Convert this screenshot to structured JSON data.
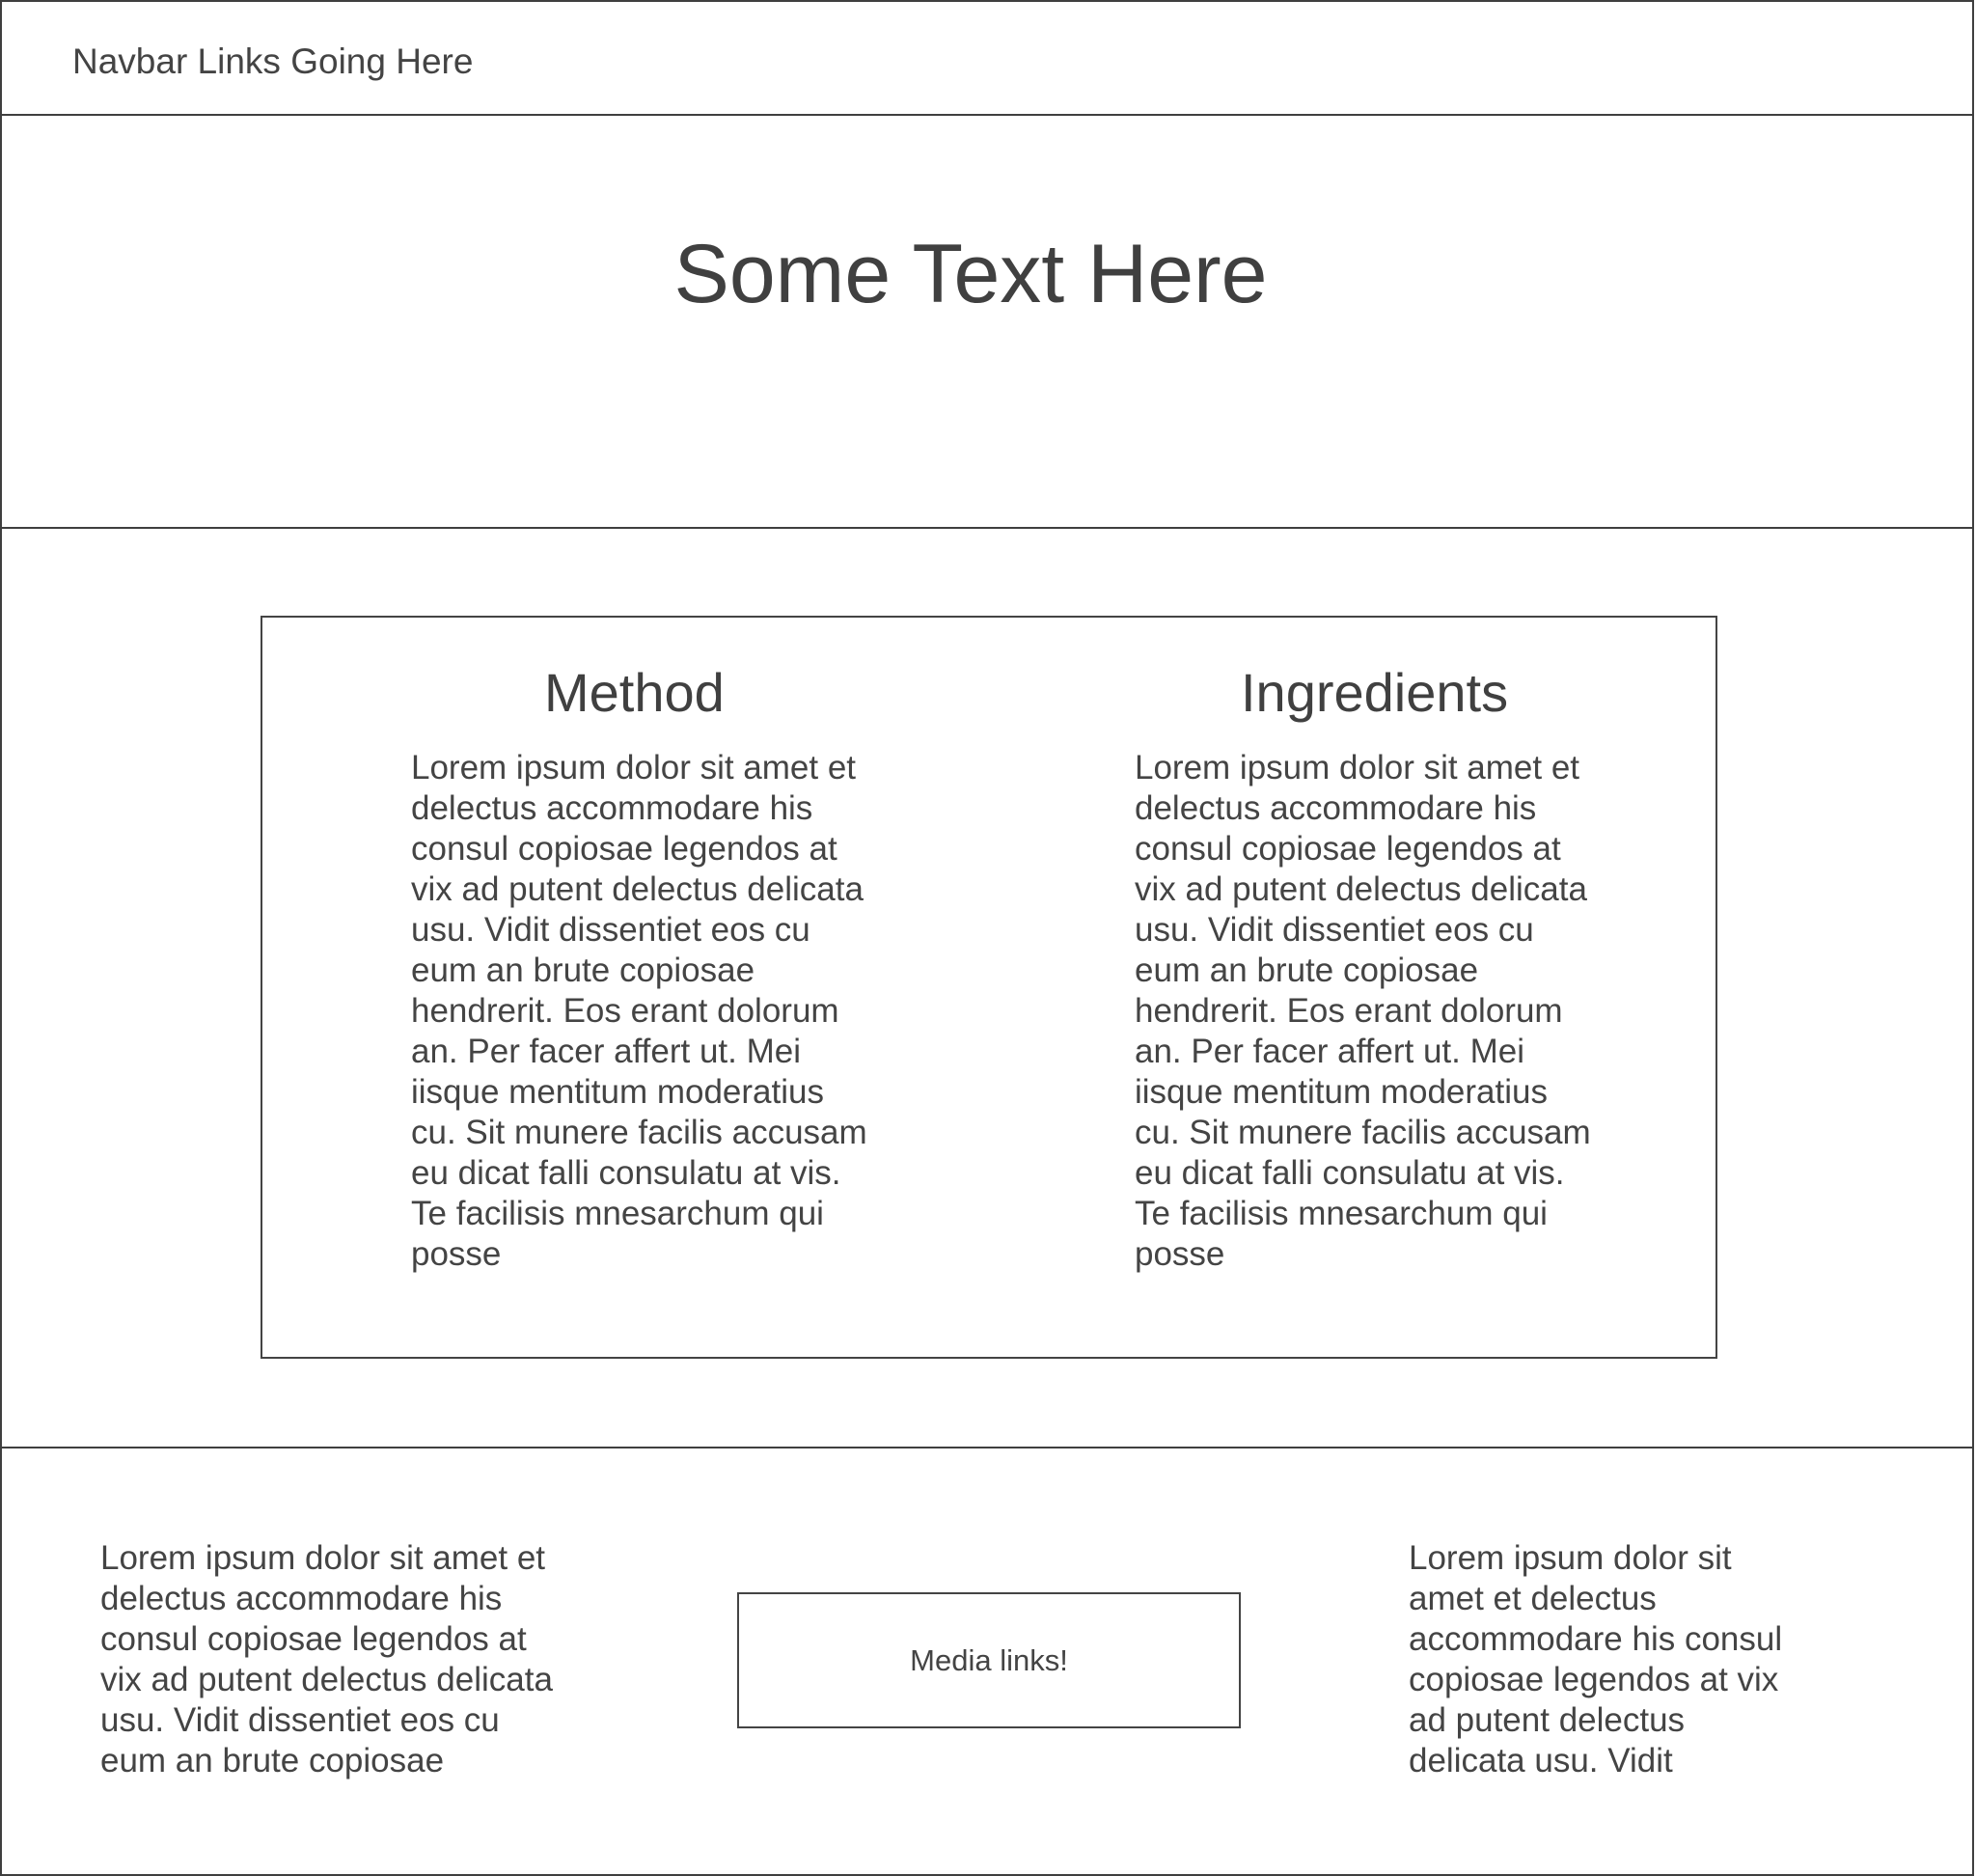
{
  "navbar": {
    "text": "Navbar Links Going Here"
  },
  "hero": {
    "title": "Some Text Here"
  },
  "content": {
    "method": {
      "title": "Method",
      "body": "Lorem ipsum dolor sit amet et\ndelectus accommodare his\nconsul copiosae legendos at\nvix ad putent delectus delicata\nusu. Vidit dissentiet eos cu\neum an brute copiosae\nhendrerit. Eos erant dolorum\nan. Per facer affert ut. Mei\niisque mentitum moderatius\ncu. Sit munere facilis accusam\neu dicat falli consulatu at vis.\nTe facilisis mnesarchum qui\nposse"
    },
    "ingredients": {
      "title": "Ingredients",
      "body": "Lorem ipsum dolor sit amet et\ndelectus accommodare his\nconsul copiosae legendos at\nvix ad putent delectus delicata\nusu. Vidit dissentiet eos cu\neum an brute copiosae\nhendrerit. Eos erant dolorum\nan. Per facer affert ut. Mei\niisque mentitum moderatius\ncu. Sit munere facilis accusam\neu dicat falli consulatu at vis.\nTe facilisis mnesarchum qui\nposse"
    }
  },
  "footer": {
    "left_text": "Lorem ipsum dolor sit amet et\ndelectus accommodare his\nconsul copiosae legendos at\nvix ad putent delectus delicata\nusu. Vidit dissentiet eos cu\neum an brute copiosae",
    "media_label": "Media links!",
    "right_text": "Lorem ipsum dolor sit\namet et delectus\naccommodare his consul\ncopiosae legendos at vix\nad putent delectus\ndelicata usu. Vidit"
  }
}
